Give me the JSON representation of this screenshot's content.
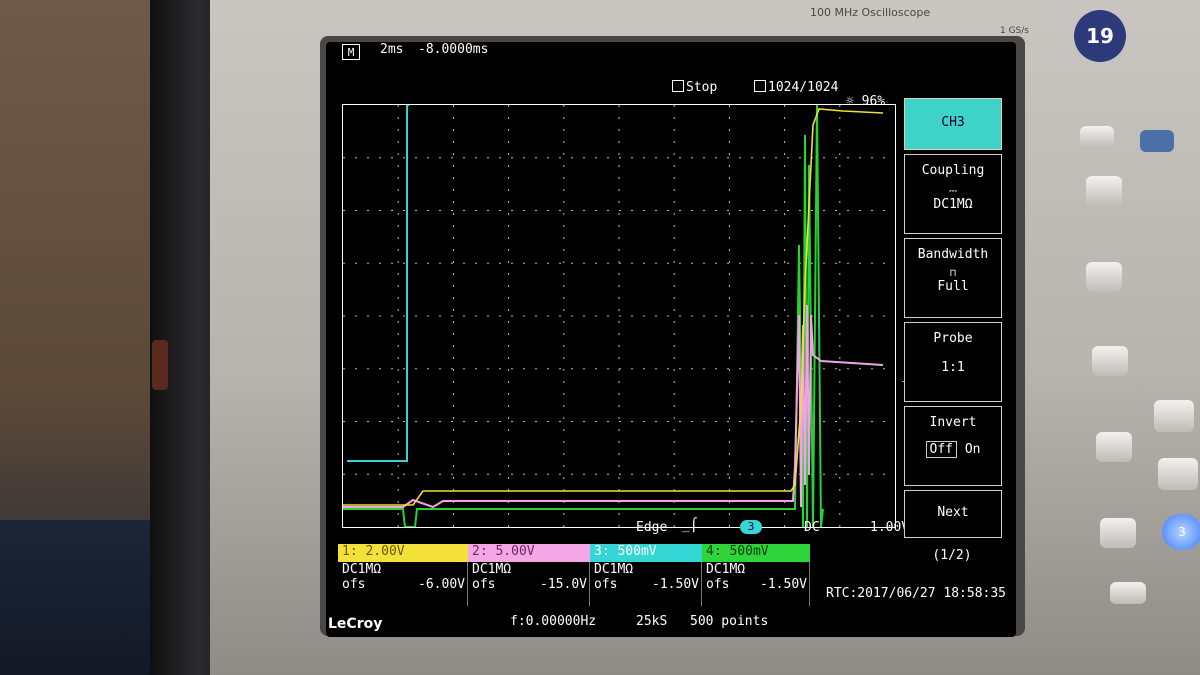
{
  "device": {
    "model_label": "100 MHz Oscilloscope",
    "rate_label": "1 GS/s",
    "badge": "19",
    "blue_button": "3"
  },
  "screen": {
    "mode_icon": "M",
    "timebase": "2ms",
    "delay": "-8.0000ms",
    "run_state": "Stop",
    "acq_count": "1024/1024",
    "brightness": "96%"
  },
  "menu": {
    "channel": "CH3",
    "coupling_label": "Coupling",
    "coupling_value": "DC1MΩ",
    "bandwidth_label": "Bandwidth",
    "bandwidth_value": "Full",
    "probe_label": "Probe",
    "probe_value": "1:1",
    "invert_label": "Invert",
    "invert_off": "Off",
    "invert_on": "On",
    "next_label": "Next",
    "page": "(1/2)"
  },
  "trigger": {
    "type": "Edge",
    "source": "3",
    "coupling": "DC",
    "level": "1.00V",
    "marker": "T"
  },
  "channels": [
    {
      "tab": "1: 2.00V",
      "coupling": "DC1MΩ",
      "ofs_label": "ofs",
      "ofs": "-6.00V",
      "color": "#f3e03a"
    },
    {
      "tab": "2: 5.00V",
      "coupling": "DC1MΩ",
      "ofs_label": "ofs",
      "ofs": "-15.0V",
      "color": "#f4a6e6"
    },
    {
      "tab": "3: 500mV",
      "coupling": "DC1MΩ",
      "ofs_label": "ofs",
      "ofs": "-1.50V",
      "color": "#35d6d6"
    },
    {
      "tab": "4: 500mV",
      "coupling": "DC1MΩ",
      "ofs_label": "ofs",
      "ofs": "-1.50V",
      "color": "#2fd33a"
    }
  ],
  "status": {
    "freq": "f:0.00000Hz",
    "sample_rate": "25kS",
    "points": "500 points",
    "rtc": "RTC:2017/06/27 18:58:35",
    "logo": "LeCroy"
  }
}
